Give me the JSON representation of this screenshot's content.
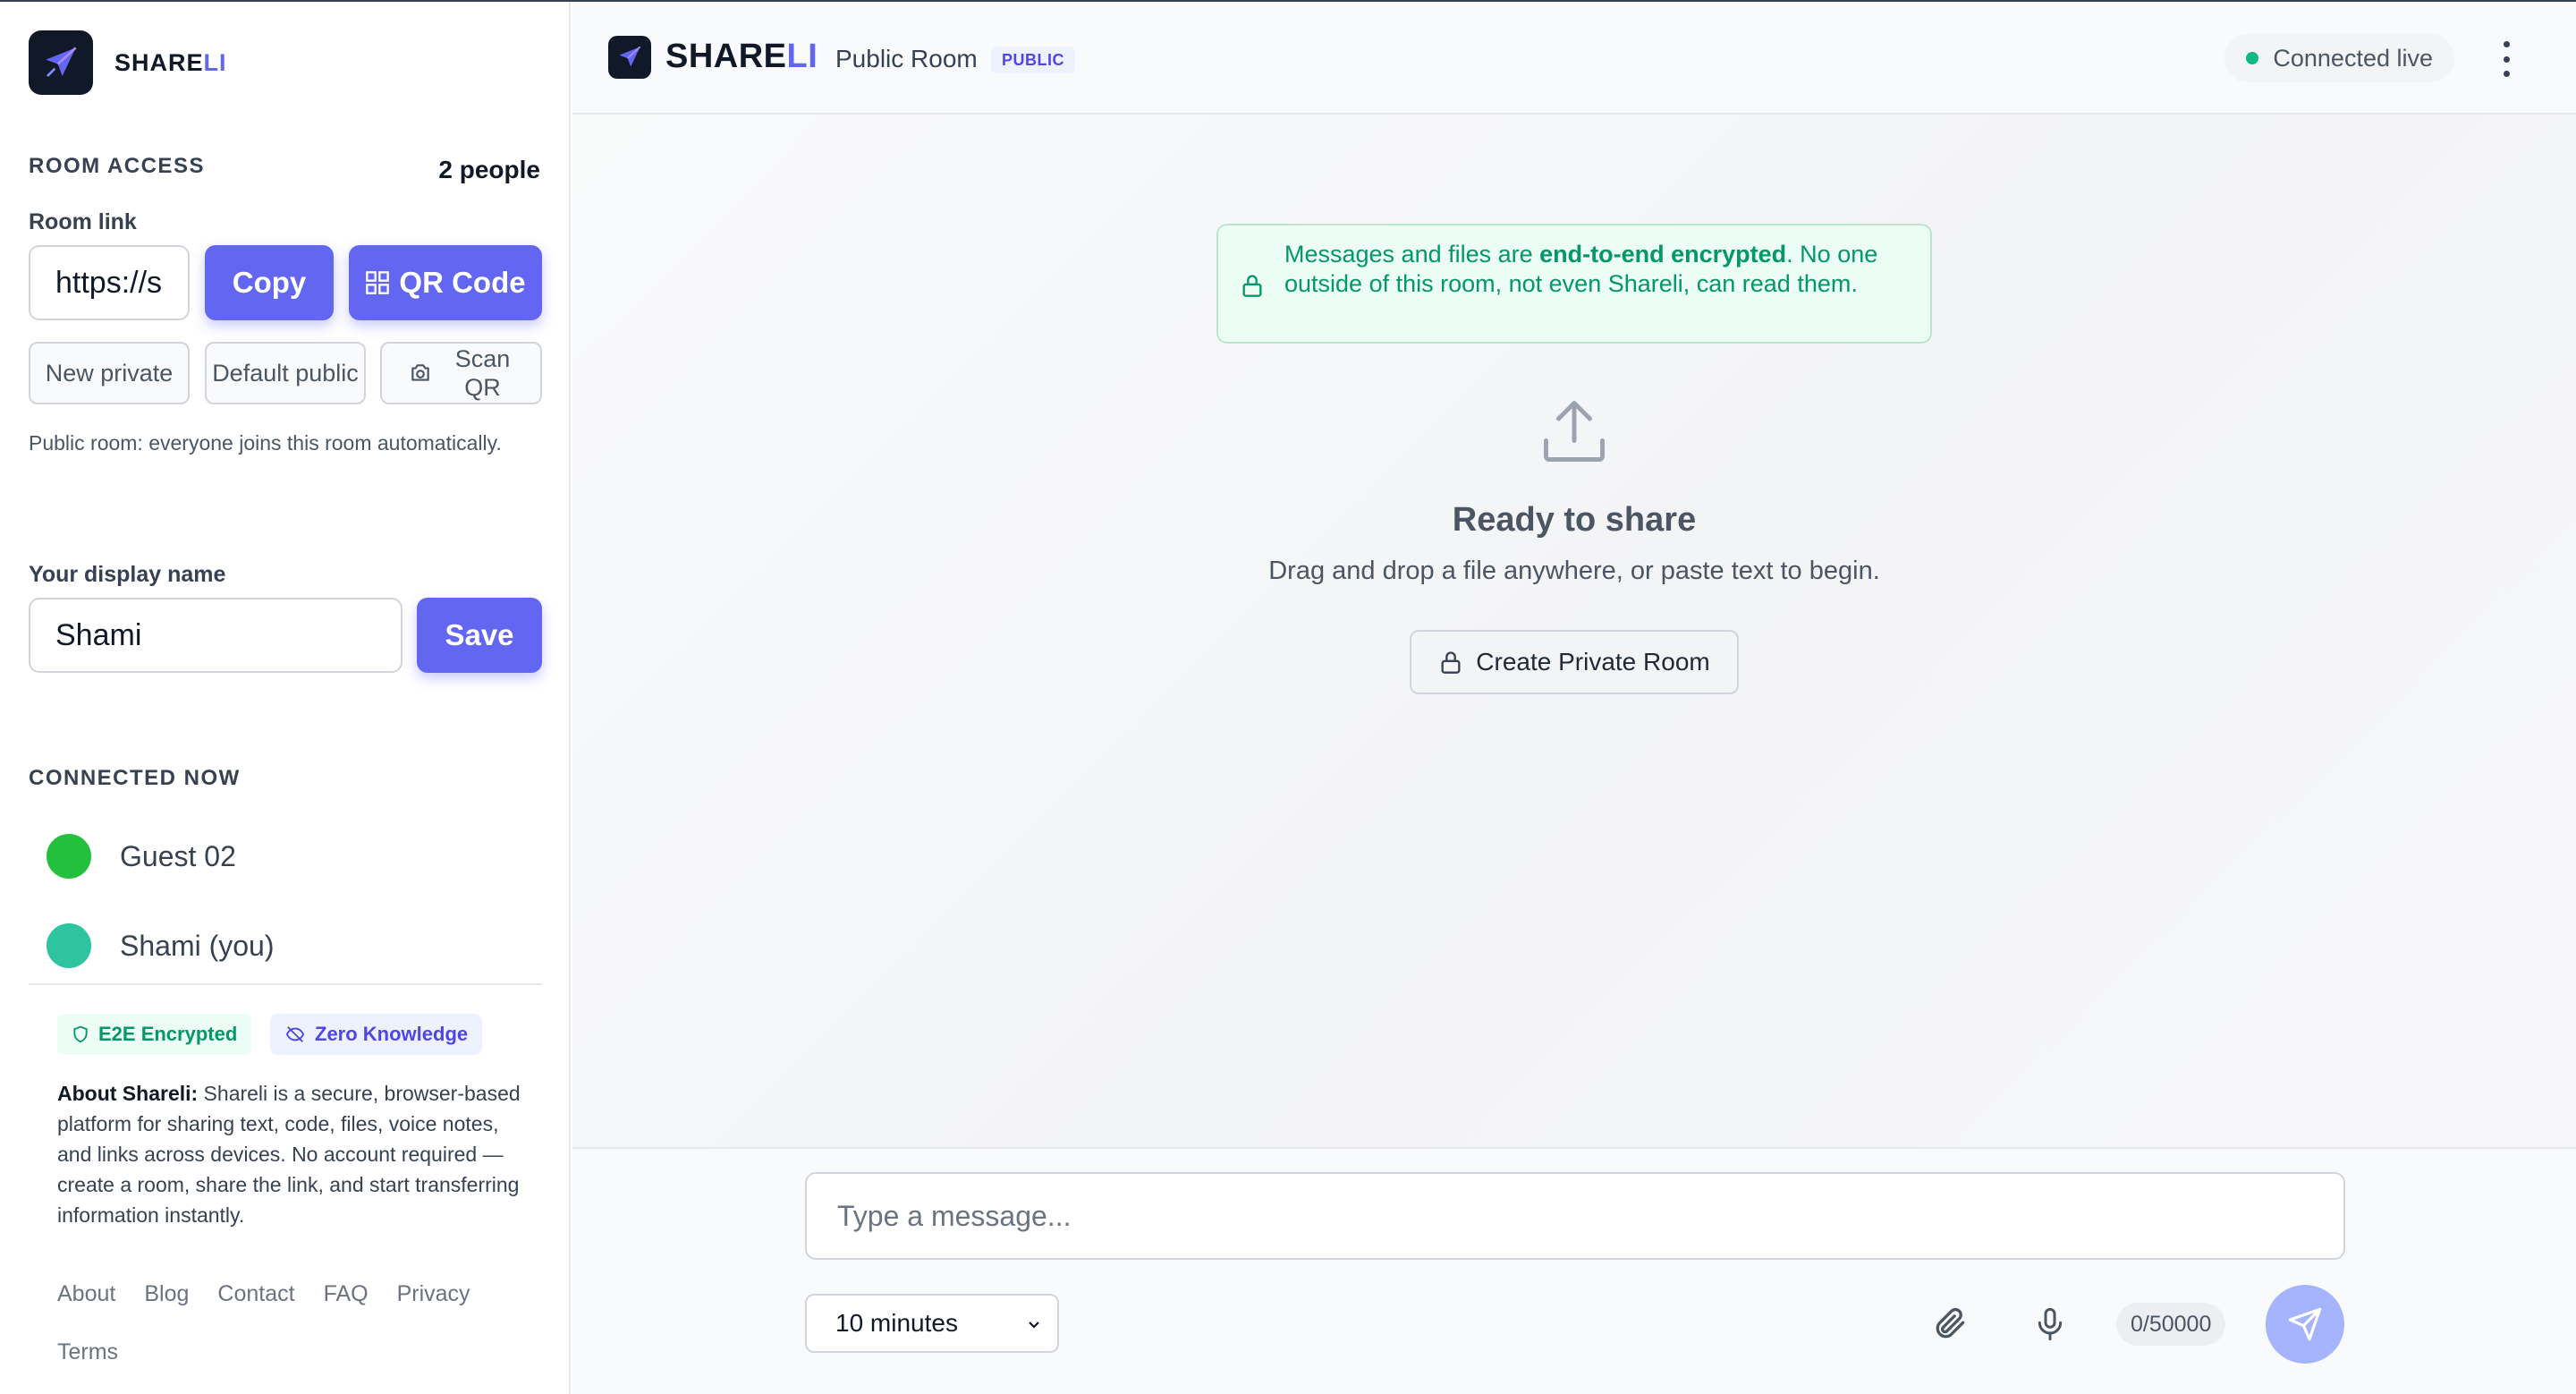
{
  "sidebar": {
    "brand": {
      "name_main": "SHARE",
      "name_accent": "LI",
      "logo_icon": "paper-plane-icon"
    },
    "room_access": {
      "heading": "ROOM ACCESS",
      "people_count": "2 people",
      "room_link_label": "Room link",
      "room_link_value": "https://s",
      "copy_label": "Copy",
      "qr_label": "QR Code",
      "new_private_label": "New private",
      "default_public_label": "Default public",
      "scan_qr_label": "Scan QR",
      "help": "Public room: everyone joins this room automatically."
    },
    "display_name": {
      "label": "Your display name",
      "value": "Shami",
      "save_label": "Save"
    },
    "connected": {
      "heading": "CONNECTED NOW",
      "users": [
        {
          "name": "Guest 02",
          "color": "#22c03c"
        },
        {
          "name": "Shami (you)",
          "color": "#2ec4a0"
        }
      ]
    },
    "badges": {
      "e2e": "E2E Encrypted",
      "zero_knowledge": "Zero Knowledge"
    },
    "about": {
      "title": "About Shareli:",
      "text": " Shareli is a secure, browser-based platform for sharing text, code, files, voice notes, and links across devices. No account required — create a room, share the link, and start transferring information instantly."
    },
    "footer_links": [
      "About",
      "Blog",
      "Contact",
      "FAQ",
      "Privacy",
      "Terms"
    ]
  },
  "header": {
    "brand_main": "SHARE",
    "brand_accent": "LI",
    "room_name": "Public Room",
    "room_badge": "PUBLIC",
    "status": "Connected live",
    "status_color": "#10b981",
    "menu_icon": "kebab-menu-icon"
  },
  "main": {
    "notice_pre": "Messages and files are ",
    "notice_bold": "end-to-end encrypted",
    "notice_post": ". No one outside of this room, not even Shareli, can read them.",
    "empty_title": "Ready to share",
    "empty_sub": "Drag and drop a file anywhere, or paste text to begin.",
    "create_private_label": "Create Private Room"
  },
  "composer": {
    "placeholder": "Type a message...",
    "ttl_value": "10 minutes",
    "char_count": "0/50000",
    "attach_icon": "paperclip-icon",
    "mic_icon": "microphone-icon",
    "send_icon": "send-icon"
  },
  "colors": {
    "accent": "#6366f1",
    "success": "#059669",
    "send_disabled": "#a5b4fc"
  }
}
